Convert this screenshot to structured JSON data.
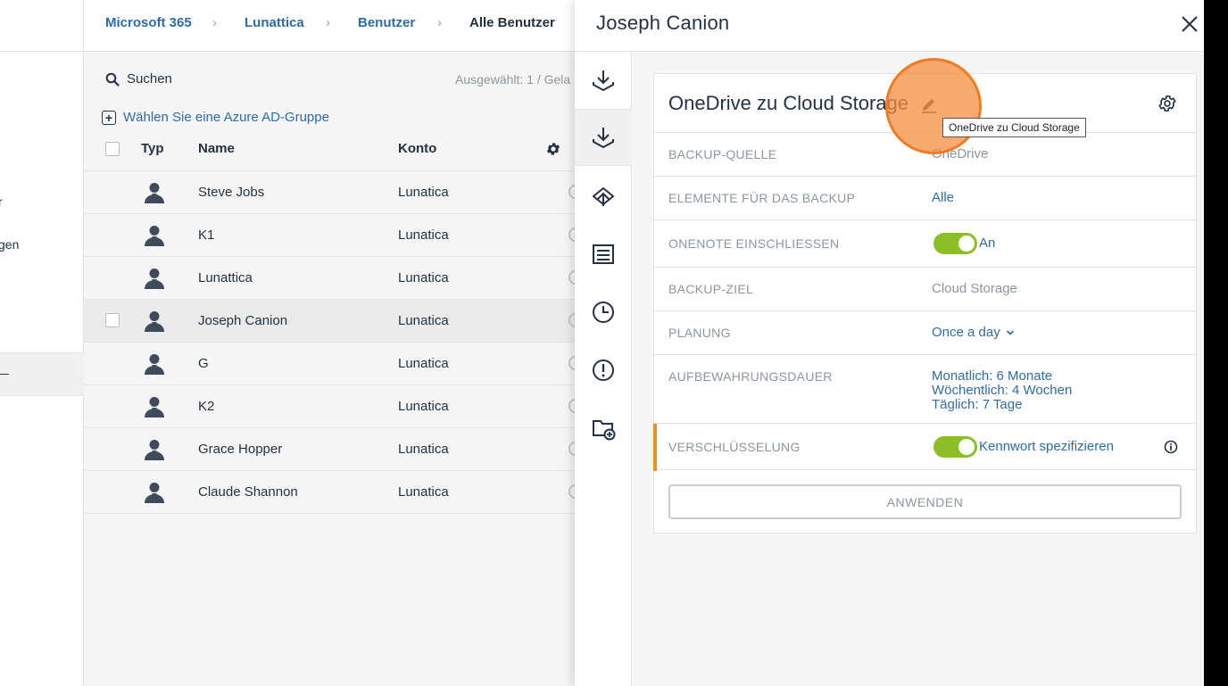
{
  "leftnav": {
    "items": [
      {
        "label": "r"
      },
      {
        "label": "gen"
      }
    ],
    "active_label": "—"
  },
  "breadcrumb": [
    "Microsoft 365",
    "Lunattica",
    "Benutzer",
    "Alle Benutzer"
  ],
  "breadcrumb_sep": "›",
  "list": {
    "search_label": "Suchen",
    "selected_info": "Ausgewählt: 1 / Gela",
    "azure_group_label": "Wählen Sie eine Azure AD-Gruppe",
    "columns": {
      "type": "Typ",
      "name": "Name",
      "account": "Konto"
    },
    "rows": [
      {
        "name": "Steve Jobs",
        "account": "Lunatica"
      },
      {
        "name": "K1",
        "account": "Lunatica"
      },
      {
        "name": "Lunattica",
        "account": "Lunatica"
      },
      {
        "name": "Joseph Canion",
        "account": "Lunatica",
        "selected": true
      },
      {
        "name": "G",
        "account": "Lunatica"
      },
      {
        "name": "K2",
        "account": "Lunatica"
      },
      {
        "name": "Grace Hopper",
        "account": "Lunatica"
      },
      {
        "name": "Claude Shannon",
        "account": "Lunatica"
      }
    ]
  },
  "panel": {
    "title": "Joseph Canion",
    "iconbar": [
      "download-icon",
      "download-icon",
      "recovery-icon",
      "log-icon",
      "clock-icon",
      "alert-icon",
      "folder-add-icon"
    ],
    "plan_title": "OneDrive zu Cloud Storage",
    "tooltip": "OneDrive zu Cloud Storage",
    "fields": {
      "source_label": "BACKUP-QUELLE",
      "source_value": "OneDrive",
      "items_label": "ELEMENTE FÜR DAS BACKUP",
      "items_value": "Alle",
      "onenote_label": "ONENOTE EINSCHLIESSEN",
      "onenote_value": "An",
      "target_label": "BACKUP-ZIEL",
      "target_value": "Cloud Storage",
      "schedule_label": "PLANUNG",
      "schedule_value": "Once a day",
      "retention_label": "AUFBEWAHRUNGSDAUER",
      "retention_monthly": "Monatlich: 6 Monate",
      "retention_weekly": "Wöchentlich: 4 Wochen",
      "retention_daily": "Täglich: 7 Tage",
      "encryption_label": "VERSCHLÜSSELUNG",
      "encryption_value": "Kennwort spezifizieren"
    },
    "onenote_enabled": true,
    "encryption_enabled": true,
    "apply_label": "ANWENDEN"
  },
  "colors": {
    "link": "#2e6ca4",
    "toggle_on": "#8cbf26",
    "accent": "#f28c28",
    "text": "#243143",
    "muted": "#8b96a0"
  }
}
